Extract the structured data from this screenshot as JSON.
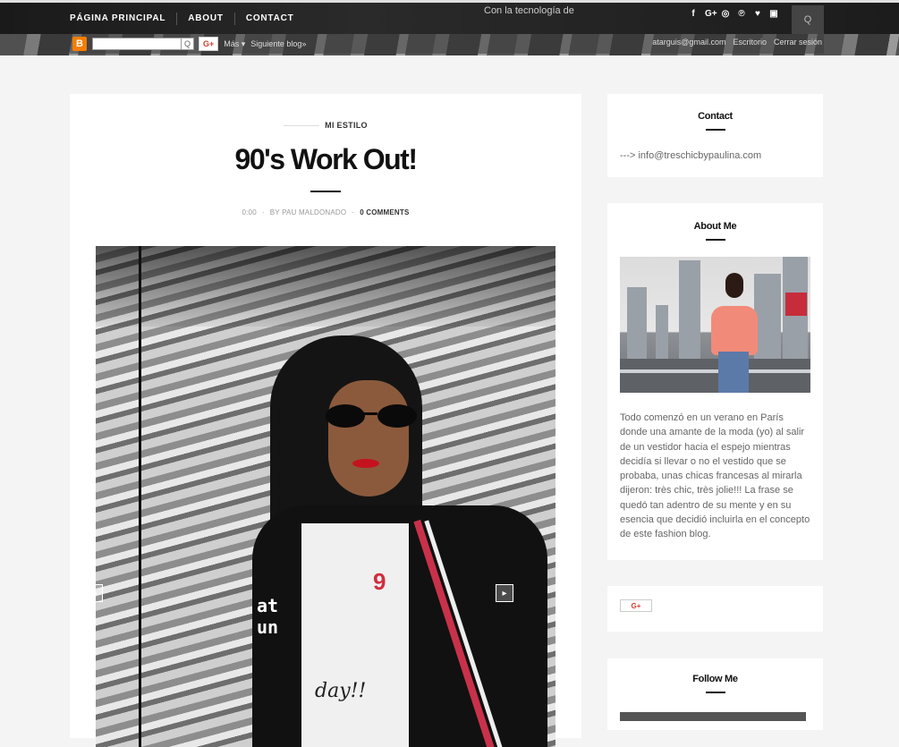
{
  "nav": {
    "items": [
      "PÁGINA PRINCIPAL",
      "ABOUT",
      "CONTACT"
    ],
    "powered_by": "Con la tecnología de",
    "social_icons": [
      "facebook-icon",
      "google-plus-icon",
      "instagram-icon",
      "pinterest-icon",
      "twitter-icon",
      "youtube-icon"
    ],
    "social_glyphs": [
      "f",
      "G+",
      "◎",
      "℗",
      "♥",
      "▣"
    ]
  },
  "blogger_bar": {
    "logo": "B",
    "search_icon": "Q",
    "gplus": "G+",
    "more": "Más ▾",
    "next_blog": "Siguiente blog»",
    "email": "atarguis@gmail.com",
    "write": "Escritorio",
    "logout": "Cerrar sesión"
  },
  "post": {
    "category": "MI ESTILO",
    "title": "90's Work Out!",
    "time": "0:00",
    "author": "BY PAU MALDONADO",
    "comments": "0 COMMENTS",
    "image_text": "at",
    "image_text2": "un",
    "image_patch": "9",
    "image_script": "day!!",
    "prev": "◂",
    "next": "▸"
  },
  "sidebar": {
    "contact": {
      "title": "Contact",
      "text": "---> info@treschicbypaulina.com"
    },
    "about": {
      "title": "About Me",
      "text": "Todo comenzó en un verano en París donde una amante de la moda (yo) al salir de un vestidor hacia el espejo mientras decidía si llevar o no el vestido que se probaba, unas chicas francesas al mirarla dijeron: très chic, très jolie!!! La frase se quedó tan adentro de su mente y en su esencia que decidió incluirla en el concepto de este fashion blog."
    },
    "gplus_share": "G+",
    "follow": {
      "title": "Follow Me"
    }
  },
  "colors": {
    "accent_red": "#d23f31",
    "blogger_orange": "#f57d00",
    "dark": "#1a1a1a"
  }
}
